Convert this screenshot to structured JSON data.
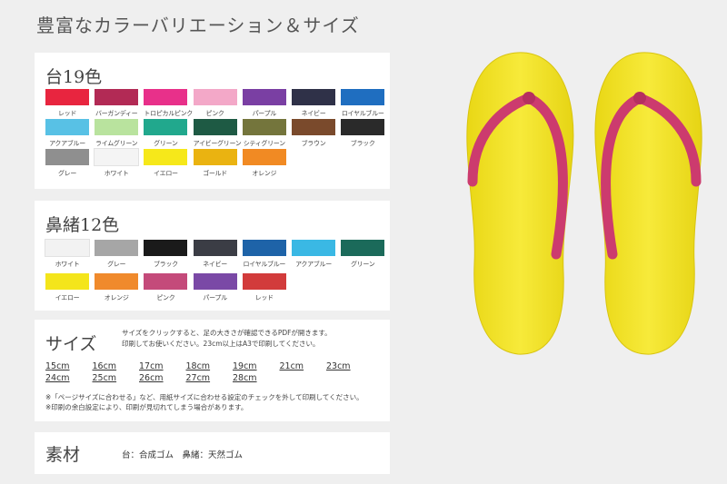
{
  "page_title": "豊富なカラーバリエーション＆サイズ",
  "base_colors": {
    "heading": "台19色",
    "items": [
      {
        "label": "レッド",
        "color": "#e8253f"
      },
      {
        "label": "バーガンディー",
        "color": "#b22a55"
      },
      {
        "label": "トロピカルピンク",
        "color": "#e8308a"
      },
      {
        "label": "ピンク",
        "color": "#f3a8c8"
      },
      {
        "label": "パープル",
        "color": "#7a3fa3"
      },
      {
        "label": "ネイビー",
        "color": "#2f3148"
      },
      {
        "label": "ロイヤルブルー",
        "color": "#1f6ec0"
      },
      {
        "label": "アクアブルー",
        "color": "#58c1e5"
      },
      {
        "label": "ライムグリーン",
        "color": "#b9e39e"
      },
      {
        "label": "グリーン",
        "color": "#21a88d"
      },
      {
        "label": "アイビーグリーン",
        "color": "#1e5a44"
      },
      {
        "label": "シティグリーン",
        "color": "#74753c"
      },
      {
        "label": "ブラウン",
        "color": "#7a4a2c"
      },
      {
        "label": "ブラック",
        "color": "#2a2a2a"
      },
      {
        "label": "グレー",
        "color": "#8f8f8f"
      },
      {
        "label": "ホワイト",
        "color": "#f4f4f4"
      },
      {
        "label": "イエロー",
        "color": "#f6e81a"
      },
      {
        "label": "ゴールド",
        "color": "#eab311"
      },
      {
        "label": "オレンジ",
        "color": "#f18a23"
      }
    ]
  },
  "strap_colors": {
    "heading": "鼻緒12色",
    "items": [
      {
        "label": "ホワイト",
        "color": "#f2f2f2"
      },
      {
        "label": "グレー",
        "color": "#a6a6a6"
      },
      {
        "label": "ブラック",
        "color": "#1a1a1a"
      },
      {
        "label": "ネイビー",
        "color": "#3b3d45"
      },
      {
        "label": "ロイヤルブルー",
        "color": "#1e63a8"
      },
      {
        "label": "アクアブルー",
        "color": "#3ab8e4"
      },
      {
        "label": "グリーン",
        "color": "#1b6a5a"
      },
      {
        "label": "イエロー",
        "color": "#f4e51b"
      },
      {
        "label": "オレンジ",
        "color": "#f08a2c"
      },
      {
        "label": "ピンク",
        "color": "#c44a7a"
      },
      {
        "label": "パープル",
        "color": "#7a49a6"
      },
      {
        "label": "レッド",
        "color": "#d23b3b"
      }
    ]
  },
  "sizes": {
    "heading": "サイズ",
    "description_line1": "サイズをクリックすると、足の大きさが確認できるPDFが開きます。",
    "description_line2": "印刷してお使いください。23cm以上はA3で印刷してください。",
    "items": [
      "15cm",
      "16cm",
      "17cm",
      "18cm",
      "19cm",
      "21cm",
      "23cm",
      "24cm",
      "25cm",
      "26cm",
      "27cm",
      "28cm"
    ],
    "note1": "※「ページサイズに合わせる」など、用紙サイズに合わせる設定のチェックを外して印刷してください。",
    "note2": "※印刷の余白設定により、印刷が見切れてしまう場合があります。"
  },
  "material": {
    "heading": "素材",
    "text": "台：合成ゴム　鼻緒：天然ゴム"
  },
  "photo": {
    "sole_color": "#f5e629",
    "strap_color": "#cc3b6e"
  }
}
